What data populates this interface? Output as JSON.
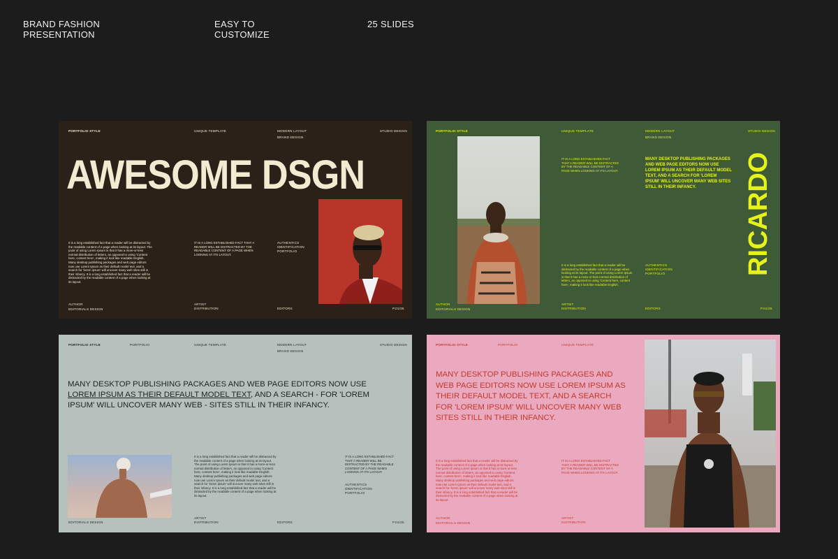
{
  "header": {
    "col1": [
      "BRAND FASHION",
      "PRESENTATION"
    ],
    "col2": [
      "EASY TO",
      "CUSTOMIZE"
    ],
    "col3": "25 SLIDES"
  },
  "slide1": {
    "portfolio_style": "PORTFOLIO STYLE",
    "unique_template": "UNIQUE TEMPLATE",
    "modern_layout": "MODERN LAYOUT",
    "brand_design": "BRAND DESIGN",
    "studio_design": "STUDIO DESIGN",
    "headline": "AWESOME DSGN",
    "body_paragraph": "It is a long established fact that a reader will be distracted by the readable content of a page when looking at its layout. The point of using Lorem Ipsum is that it has a more-or-less normal distribution of letters, as opposed to using 'Content here, content here', making it look like readable English. Many desktop publishing packages and web page editors now use Lorem Ipsum as their default model text, and a search for 'lorem ipsum' will uncover many web sites still in their infancy. It is a long established fact that a reader will be distracted by the readable content of a page when looking at its layout.",
    "mid_paragraph": "IT IS A LONG ESTABLISHED FACT THAT A READER WILL BE DISTRACTED BY THE READABLE CONTENT OF A PAGE WHEN LOOKING AT ITS LAYOUT.",
    "tags": [
      "AUTHENTICS",
      "IDENTIFICATION",
      "PORTFOLIO"
    ],
    "author": "AUTHOR",
    "editorials": "EDITORIALS DESIGN",
    "artist": "ARTIST",
    "distribution": "DISTRIBUTION",
    "editors": "EDITORS",
    "page": "P.01/25"
  },
  "slide2": {
    "portfolio_style": "PORTFOLIO STYLE",
    "unique_template": "UNIQUE TEMPLATE",
    "modern_layout": "MODERN LAYOUT",
    "brand_design": "BRAND DESIGN",
    "studio_design": "STUDIO DESIGN",
    "mid_paragraph": "IT IS A LONG ESTABLISHED FACT THAT A READER WILL BE DISTRACTED BY THE READABLE CONTENT OF A PAGE WHEN LOOKING AT ITS LAYOUT.",
    "right_paragraph": "MANY DESKTOP PUBLISHING PACKAGES AND WEB PAGE EDITORS NOW USE LOREM IPSUM AS THEIR DEFAULT MODEL TEXT, AND A SEARCH FOR 'LOREM IPSUM' WILL UNCOVER MANY WEB SITES STILL IN THEIR INFANCY.",
    "vertical_name": "RICARDO",
    "lower_paragraph": "It is a long established fact that a reader will be distracted by the readable content of a page when looking at its layout. The point of using Lorem Ipsum is that it has a more-or-less normal distribution of letters, as opposed to using 'Content here, content here', making it look like readable English.",
    "tags": [
      "AUTHENTICS",
      "IDENTIFICATION",
      "PORTFOLIO"
    ],
    "author": "AUTHOR",
    "editorials": "EDITORIALS DESIGN",
    "artist": "ARTIST",
    "distribution": "DISTRIBUTION",
    "editors": "EDITORS",
    "page": "P.01/25"
  },
  "slide3": {
    "portfolio_style": "PORTFOLIO STYLE",
    "portfolio": "PORTFOLIO",
    "unique_template": "UNIQUE TEMPLATE",
    "modern_layout": "MODERN LAYOUT",
    "brand_design": "BRAND DESIGN",
    "studio_design": "STUDIO DESIGN",
    "headline_line1": "MANY DESKTOP PUBLISHING PACKAGES AND WEB PAGE EDITORS NOW USE",
    "headline_underlined": "LOREM IPSUM AS THEIR DEFAULT MODEL TEXT",
    "headline_line2_rest": ", AND A SEARCH - FOR 'LOREM",
    "headline_line3": "IPSUM' WILL UNCOVER MANY WEB - SITES STILL IN THEIR INFANCY.",
    "body_paragraph": "It is a long established fact that a reader will be distracted by the readable content of a page when looking at its layout. The point of using Lorem Ipsum is that it has a more-or-less normal distribution of letters, as opposed to using 'Content here, content here', making it look like readable English. Many desktop publishing packages and web page editors now use Lorem Ipsum as their default model text, and a search for 'lorem ipsum' will uncover many web sites still in their infancy. It is a long established fact that a reader will be distracted by the readable content of a page when looking at its layout.",
    "right_paragraph": "IT IS A LONG ESTABLISHED FACT THAT A READER WILL BE DISTRACTED BY THE READABLE CONTENT OF A PAGE WHEN LOOKING AT ITS LAYOUT.",
    "tags": [
      "AUTHENTICS",
      "IDENTIFICATION",
      "PORTFOLIO"
    ],
    "editorials": "EDITORIALS DESIGN",
    "artist": "ARTIST",
    "distribution": "DISTRIBUTION",
    "editors": "EDITORS",
    "page": "P.01/25"
  },
  "slide4": {
    "portfolio_style": "PORTFOLIO STYLE",
    "portfolio": "PORTFOLIO",
    "unique_template": "UNIQUE TEMPLATE",
    "headline": "MANY DESKTOP PUBLISHING PACKAGES AND WEB PAGE EDITORS NOW USE LOREM IPSUM AS THEIR DEFAULT MODEL TEXT, AND A SEARCH FOR 'LOREM IPSUM' WILL UNCOVER MANY WEB SITES STILL IN THEIR INFANCY.",
    "body_paragraph": "It is a long established fact that a reader will be distracted by the readable content of a page when looking at its layout. The point of using Lorem Ipsum is that it has a more-or-less normal distribution of letters, as opposed to using 'Content here, content here', making it look like readable English. Many desktop publishing packages and web page editors now use Lorem Ipsum as their default model text, and a search for 'lorem ipsum' will uncover many web sites still in their infancy. It is a long established fact that a reader will be distracted by the readable content of a page when looking at its layout.",
    "mid_paragraph": "IT IS A LONG ESTABLISHED FACT THAT A READER WILL BE DISTRACTED BY THE READABLE CONTENT OF A PAGE WHEN LOOKING AT ITS LAYOUT.",
    "author": "AUTHOR",
    "editorials": "EDITORIALS DESIGN",
    "artist": "ARTIST",
    "distribution": "DISTRIBUTION"
  },
  "colors": {
    "page_bg": "#1c1c1c",
    "slide1_bg": "#2b2118",
    "slide1_text": "#f3ead2",
    "slide2_bg": "#3f5a36",
    "slide2_text": "#e6f21c",
    "slide3_bg": "#b6c0bc",
    "slide3_text": "#1f2420",
    "slide4_bg": "#eba9bf",
    "slide4_text": "#c0392b"
  }
}
